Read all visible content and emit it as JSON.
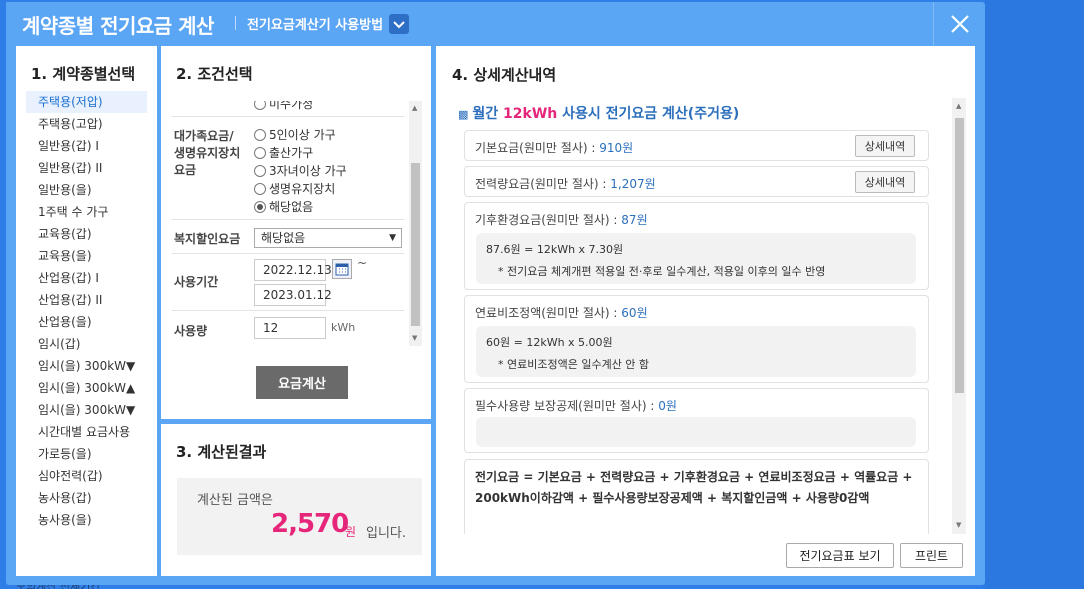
{
  "page": {
    "behind_text": "모의계산 전체기간"
  },
  "modal": {
    "title": "계약종별 전기요금 계산",
    "help_link": "전기요금계산기 사용방법",
    "icons": {
      "help_toggle": "chevron-down-icon",
      "close": "close-icon"
    }
  },
  "contract_panel": {
    "title": "1. 계약종별선택",
    "selected_index": 0,
    "items": [
      "주택용(저압)",
      "주택용(고압)",
      "일반용(갑) I",
      "일반용(갑) II",
      "일반용(을)",
      "1주택 수 가구",
      "교육용(갑)",
      "교육용(을)",
      "산업용(갑) I",
      "산업용(갑) II",
      "산업용(을)",
      "임시(갑)",
      "임시(을) 300kW▼",
      "임시(을) 300kW▲",
      "임시(을) 300kW▼",
      "시간대별 요금사용",
      "가로등(을)",
      "심야전력(갑)",
      "농사용(갑)",
      "농사용(을)"
    ]
  },
  "condition_panel": {
    "title": "2. 조건선택",
    "cut_radio_label": "미수가정",
    "family_discount": {
      "label": "대가족요금/ 생명유지장치 요금",
      "options": [
        {
          "label": "5인이상 가구",
          "checked": false
        },
        {
          "label": "출산가구",
          "checked": false
        },
        {
          "label": "3자녀이상 가구",
          "checked": false
        },
        {
          "label": "생명유지장치",
          "checked": false
        },
        {
          "label": "해당없음",
          "checked": true
        }
      ]
    },
    "welfare": {
      "label": "복지할인요금",
      "value": "해당없음"
    },
    "period": {
      "label": "사용기간",
      "start": "2022.12.13",
      "end": "2023.01.12",
      "separator": "~",
      "calendar_icon": "calendar-icon"
    },
    "usage": {
      "label": "사용량",
      "value": "12",
      "unit": "kWh"
    },
    "calc_button": "요금계산"
  },
  "result_panel": {
    "title": "3. 계산된결과",
    "label": "계산된 금액은",
    "amount": "2,570",
    "unit": "원",
    "tail": "입니다."
  },
  "detail_panel": {
    "title": "4. 상세계산내역",
    "heading": {
      "marker": "▩",
      "prefix": "월간 ",
      "highlight": "12kWh",
      "suffix": " 사용시 전기요금 계산(주거용)"
    },
    "base_fee": {
      "label": "기본요금(원미만 절사) : ",
      "value": "910원",
      "button": "상세내역"
    },
    "energy_fee": {
      "label": "전력량요금(원미만 절사) : ",
      "value": "1,207원",
      "button": "상세내역"
    },
    "climate_fee": {
      "label": "기후환경요금(원미만 절사) : ",
      "value": "87원",
      "calc": "87.6원 = 12kWh x 7.30원",
      "note": "* 전기요금 체계개편 적용일 전·후로 일수계산, 적용일 이후의 일수 반영"
    },
    "fuel_fee": {
      "label": "연료비조정액(원미만 절사) : ",
      "value": "60원",
      "calc": "60원 = 12kWh x 5.00원",
      "note": "* 연료비조정액은 일수계산 안 함"
    },
    "essential_deduction": {
      "label": "필수사용량 보장공제(원미만 절사) : ",
      "value": "0원"
    },
    "formula": "전기요금 = 기본요금 + 전력량요금 + 기후환경요금 + 연료비조정요금 + 역률요금 + 200kWh이하감액 + 필수사용량보장공제액 + 복지할인금액 + 사용량0감액",
    "buttons": {
      "rate_table": "전기요금표 보기",
      "print": "프린트"
    }
  }
}
